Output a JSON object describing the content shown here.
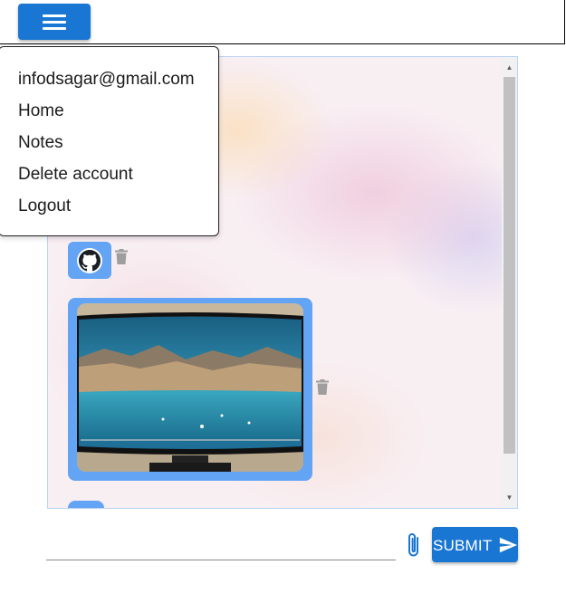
{
  "menu": {
    "items": [
      {
        "label": "infodsagar@gmail.com"
      },
      {
        "label": "Home"
      },
      {
        "label": "Notes"
      },
      {
        "label": "Delete account"
      },
      {
        "label": "Logout"
      }
    ]
  },
  "composer": {
    "input_value": "",
    "input_placeholder": "",
    "submit_label": "SUBMIT"
  },
  "icons": {
    "menu": "hamburger-icon",
    "github": "github-icon",
    "delete": "trash-icon",
    "attach": "paperclip-icon",
    "send": "send-icon"
  },
  "colors": {
    "primary": "#1976d2",
    "bubble": "#64a4f5",
    "trash": "#9e9e9e"
  }
}
